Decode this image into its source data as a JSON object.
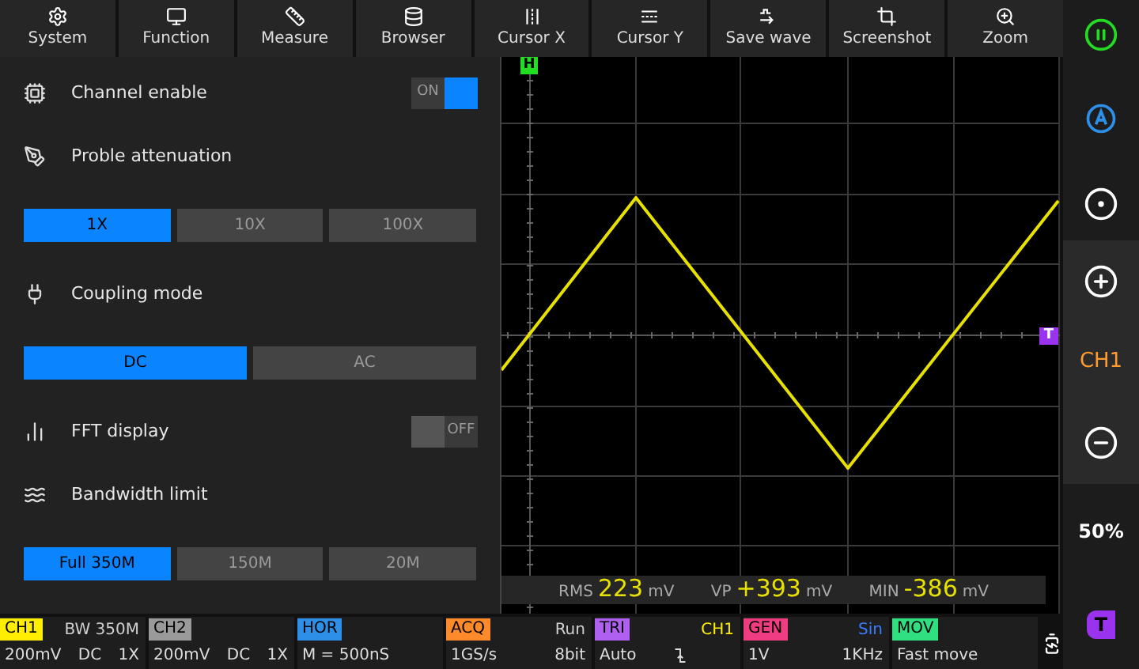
{
  "menu": [
    {
      "label": "System"
    },
    {
      "label": "Function"
    },
    {
      "label": "Measure"
    },
    {
      "label": "Browser"
    },
    {
      "label": "Cursor X"
    },
    {
      "label": "Cursor Y"
    },
    {
      "label": "Save wave"
    },
    {
      "label": "Screenshot"
    },
    {
      "label": "Zoom"
    }
  ],
  "panel": {
    "settings": [
      {
        "kind": "toggle",
        "label": "Channel enable",
        "on": true,
        "state_text": "ON"
      },
      {
        "kind": "heading",
        "label": "Proble attenuation"
      },
      {
        "kind": "options",
        "options": [
          {
            "label": "1X",
            "selected": true
          },
          {
            "label": "10X",
            "selected": false
          },
          {
            "label": "100X",
            "selected": false
          }
        ]
      },
      {
        "kind": "heading",
        "label": "Coupling mode"
      },
      {
        "kind": "options",
        "options": [
          {
            "label": "DC",
            "selected": true
          },
          {
            "label": "AC",
            "selected": false
          }
        ]
      },
      {
        "kind": "toggle",
        "label": "FFT display",
        "on": false,
        "state_text": "OFF"
      },
      {
        "kind": "heading",
        "label": "Bandwidth limit"
      },
      {
        "kind": "options",
        "options": [
          {
            "label": "Full 350M",
            "selected": true
          },
          {
            "label": "150M",
            "selected": false
          },
          {
            "label": "20M",
            "selected": false
          }
        ]
      }
    ]
  },
  "scope": {
    "h_marker": "H",
    "t_marker": "T",
    "measurements": [
      {
        "label": "RMS",
        "value": "223",
        "unit": "mV"
      },
      {
        "label": "VP",
        "value": "+393",
        "unit": "mV"
      },
      {
        "label": "MIN",
        "value": "-386",
        "unit": "mV"
      }
    ]
  },
  "sidebar": {
    "channel": "CH1",
    "trigger_level": "50%",
    "trigger_marker": "T"
  },
  "status_bar": [
    {
      "tag": "CH1",
      "color": "#ffee00",
      "info": {
        "text": "BW 350M",
        "color": "#d0d0d0"
      },
      "values": [
        "200mV",
        "DC",
        "1X"
      ]
    },
    {
      "tag": "CH2",
      "color": "#9a9a9a",
      "values": [
        "200mV",
        "DC",
        "1X"
      ]
    },
    {
      "tag": "HOR",
      "color": "#2e8fe8",
      "values": [
        "M = 500nS"
      ]
    },
    {
      "tag": "ACQ",
      "color": "#ff8a2a",
      "info": {
        "text": "Run",
        "color": "#d0d0d0"
      },
      "values": [
        "1GS/s",
        "8bit"
      ]
    },
    {
      "tag": "TRI",
      "color": "#b060f0",
      "info": {
        "text": "CH1",
        "color": "#ffee00"
      },
      "values": [
        "Auto"
      ],
      "falling_edge": true
    },
    {
      "tag": "GEN",
      "color": "#f03c80",
      "info": {
        "text": "Sin",
        "color": "#3a7cff"
      },
      "values": [
        "1V",
        "1KHz"
      ]
    },
    {
      "tag": "MOV",
      "color": "#30e080",
      "values": [
        "Fast move"
      ]
    }
  ]
}
